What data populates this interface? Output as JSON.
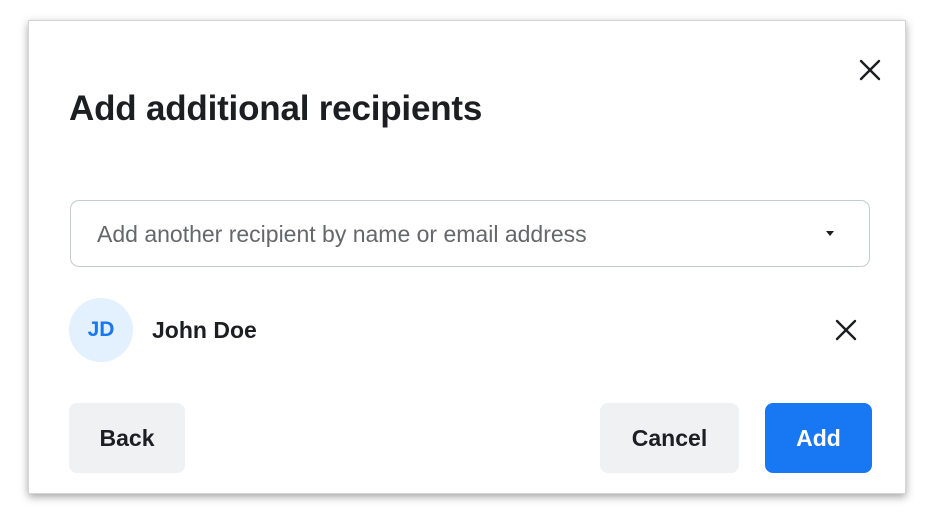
{
  "dialog": {
    "title": "Add additional recipients",
    "close_icon": "close-icon"
  },
  "recipient_input": {
    "placeholder": "Add another recipient by name or email address",
    "dropdown_icon": "caret-down-icon"
  },
  "recipients": [
    {
      "initials": "JD",
      "name": "John Doe",
      "remove_icon": "close-icon"
    }
  ],
  "footer": {
    "back_label": "Back",
    "cancel_label": "Cancel",
    "add_label": "Add"
  },
  "colors": {
    "primary": "#1877f2",
    "secondary_button": "#eff1f3",
    "avatar_background": "#e3f0fd",
    "text_primary": "#1c1e21",
    "text_placeholder": "#65676b"
  }
}
